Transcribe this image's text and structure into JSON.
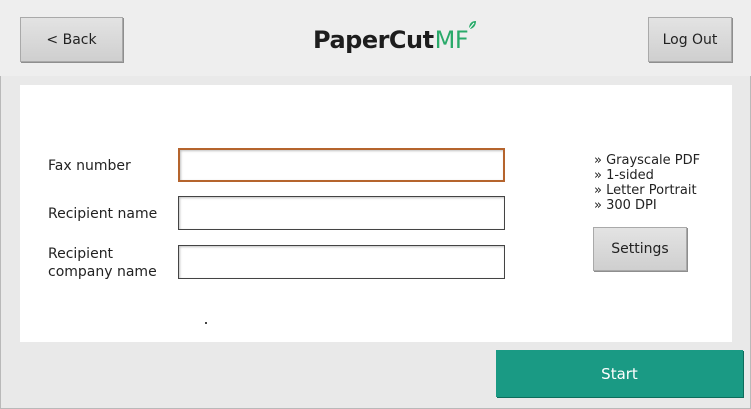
{
  "header": {
    "back_label": "< Back",
    "logout_label": "Log Out",
    "logo_main": "PaperCut",
    "logo_suffix": "MF"
  },
  "form": {
    "fax_number_label": "Fax number",
    "fax_number_value": "",
    "recipient_name_label": "Recipient name",
    "recipient_name_value": "",
    "company_label_line1": "Recipient",
    "company_label_line2": "company name",
    "company_value": ""
  },
  "settings": {
    "items": [
      "» Grayscale PDF",
      "» 1-sided",
      "» Letter Portrait",
      "» 300 DPI"
    ],
    "button_label": "Settings"
  },
  "footer": {
    "start_label": "Start"
  },
  "colors": {
    "start_button": "#1a9a84",
    "logo_accent": "#2aaa6a",
    "focused_field_border": "#b5642d"
  }
}
